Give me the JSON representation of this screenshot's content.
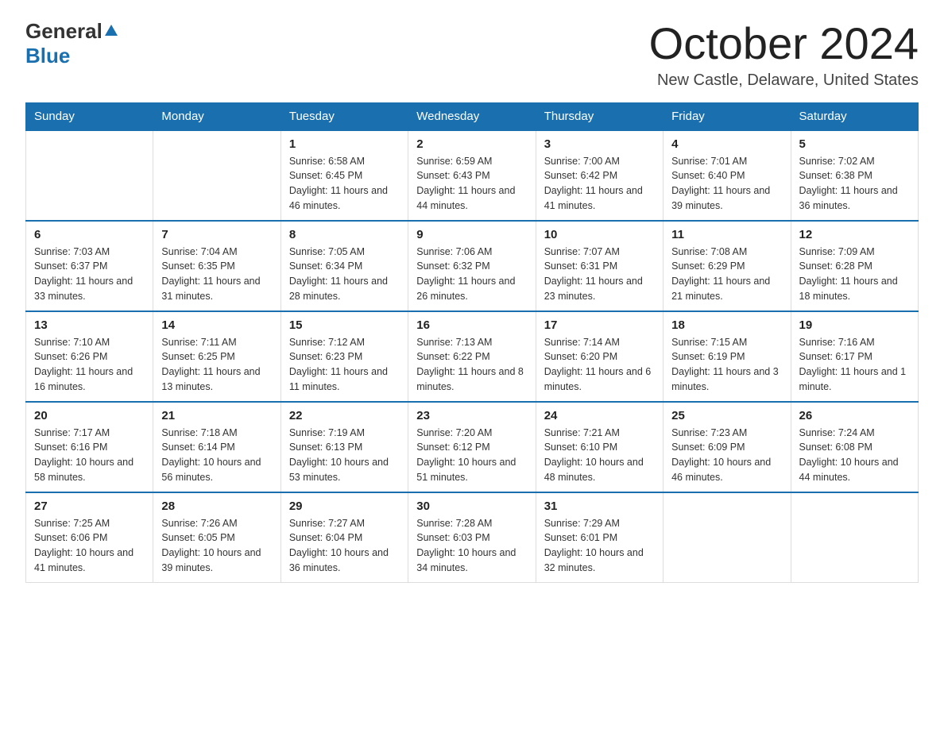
{
  "logo": {
    "general": "General",
    "blue": "Blue"
  },
  "title": "October 2024",
  "location": "New Castle, Delaware, United States",
  "days_of_week": [
    "Sunday",
    "Monday",
    "Tuesday",
    "Wednesday",
    "Thursday",
    "Friday",
    "Saturday"
  ],
  "weeks": [
    [
      {
        "day": "",
        "sunrise": "",
        "sunset": "",
        "daylight": ""
      },
      {
        "day": "",
        "sunrise": "",
        "sunset": "",
        "daylight": ""
      },
      {
        "day": "1",
        "sunrise": "Sunrise: 6:58 AM",
        "sunset": "Sunset: 6:45 PM",
        "daylight": "Daylight: 11 hours and 46 minutes."
      },
      {
        "day": "2",
        "sunrise": "Sunrise: 6:59 AM",
        "sunset": "Sunset: 6:43 PM",
        "daylight": "Daylight: 11 hours and 44 minutes."
      },
      {
        "day": "3",
        "sunrise": "Sunrise: 7:00 AM",
        "sunset": "Sunset: 6:42 PM",
        "daylight": "Daylight: 11 hours and 41 minutes."
      },
      {
        "day": "4",
        "sunrise": "Sunrise: 7:01 AM",
        "sunset": "Sunset: 6:40 PM",
        "daylight": "Daylight: 11 hours and 39 minutes."
      },
      {
        "day": "5",
        "sunrise": "Sunrise: 7:02 AM",
        "sunset": "Sunset: 6:38 PM",
        "daylight": "Daylight: 11 hours and 36 minutes."
      }
    ],
    [
      {
        "day": "6",
        "sunrise": "Sunrise: 7:03 AM",
        "sunset": "Sunset: 6:37 PM",
        "daylight": "Daylight: 11 hours and 33 minutes."
      },
      {
        "day": "7",
        "sunrise": "Sunrise: 7:04 AM",
        "sunset": "Sunset: 6:35 PM",
        "daylight": "Daylight: 11 hours and 31 minutes."
      },
      {
        "day": "8",
        "sunrise": "Sunrise: 7:05 AM",
        "sunset": "Sunset: 6:34 PM",
        "daylight": "Daylight: 11 hours and 28 minutes."
      },
      {
        "day": "9",
        "sunrise": "Sunrise: 7:06 AM",
        "sunset": "Sunset: 6:32 PM",
        "daylight": "Daylight: 11 hours and 26 minutes."
      },
      {
        "day": "10",
        "sunrise": "Sunrise: 7:07 AM",
        "sunset": "Sunset: 6:31 PM",
        "daylight": "Daylight: 11 hours and 23 minutes."
      },
      {
        "day": "11",
        "sunrise": "Sunrise: 7:08 AM",
        "sunset": "Sunset: 6:29 PM",
        "daylight": "Daylight: 11 hours and 21 minutes."
      },
      {
        "day": "12",
        "sunrise": "Sunrise: 7:09 AM",
        "sunset": "Sunset: 6:28 PM",
        "daylight": "Daylight: 11 hours and 18 minutes."
      }
    ],
    [
      {
        "day": "13",
        "sunrise": "Sunrise: 7:10 AM",
        "sunset": "Sunset: 6:26 PM",
        "daylight": "Daylight: 11 hours and 16 minutes."
      },
      {
        "day": "14",
        "sunrise": "Sunrise: 7:11 AM",
        "sunset": "Sunset: 6:25 PM",
        "daylight": "Daylight: 11 hours and 13 minutes."
      },
      {
        "day": "15",
        "sunrise": "Sunrise: 7:12 AM",
        "sunset": "Sunset: 6:23 PM",
        "daylight": "Daylight: 11 hours and 11 minutes."
      },
      {
        "day": "16",
        "sunrise": "Sunrise: 7:13 AM",
        "sunset": "Sunset: 6:22 PM",
        "daylight": "Daylight: 11 hours and 8 minutes."
      },
      {
        "day": "17",
        "sunrise": "Sunrise: 7:14 AM",
        "sunset": "Sunset: 6:20 PM",
        "daylight": "Daylight: 11 hours and 6 minutes."
      },
      {
        "day": "18",
        "sunrise": "Sunrise: 7:15 AM",
        "sunset": "Sunset: 6:19 PM",
        "daylight": "Daylight: 11 hours and 3 minutes."
      },
      {
        "day": "19",
        "sunrise": "Sunrise: 7:16 AM",
        "sunset": "Sunset: 6:17 PM",
        "daylight": "Daylight: 11 hours and 1 minute."
      }
    ],
    [
      {
        "day": "20",
        "sunrise": "Sunrise: 7:17 AM",
        "sunset": "Sunset: 6:16 PM",
        "daylight": "Daylight: 10 hours and 58 minutes."
      },
      {
        "day": "21",
        "sunrise": "Sunrise: 7:18 AM",
        "sunset": "Sunset: 6:14 PM",
        "daylight": "Daylight: 10 hours and 56 minutes."
      },
      {
        "day": "22",
        "sunrise": "Sunrise: 7:19 AM",
        "sunset": "Sunset: 6:13 PM",
        "daylight": "Daylight: 10 hours and 53 minutes."
      },
      {
        "day": "23",
        "sunrise": "Sunrise: 7:20 AM",
        "sunset": "Sunset: 6:12 PM",
        "daylight": "Daylight: 10 hours and 51 minutes."
      },
      {
        "day": "24",
        "sunrise": "Sunrise: 7:21 AM",
        "sunset": "Sunset: 6:10 PM",
        "daylight": "Daylight: 10 hours and 48 minutes."
      },
      {
        "day": "25",
        "sunrise": "Sunrise: 7:23 AM",
        "sunset": "Sunset: 6:09 PM",
        "daylight": "Daylight: 10 hours and 46 minutes."
      },
      {
        "day": "26",
        "sunrise": "Sunrise: 7:24 AM",
        "sunset": "Sunset: 6:08 PM",
        "daylight": "Daylight: 10 hours and 44 minutes."
      }
    ],
    [
      {
        "day": "27",
        "sunrise": "Sunrise: 7:25 AM",
        "sunset": "Sunset: 6:06 PM",
        "daylight": "Daylight: 10 hours and 41 minutes."
      },
      {
        "day": "28",
        "sunrise": "Sunrise: 7:26 AM",
        "sunset": "Sunset: 6:05 PM",
        "daylight": "Daylight: 10 hours and 39 minutes."
      },
      {
        "day": "29",
        "sunrise": "Sunrise: 7:27 AM",
        "sunset": "Sunset: 6:04 PM",
        "daylight": "Daylight: 10 hours and 36 minutes."
      },
      {
        "day": "30",
        "sunrise": "Sunrise: 7:28 AM",
        "sunset": "Sunset: 6:03 PM",
        "daylight": "Daylight: 10 hours and 34 minutes."
      },
      {
        "day": "31",
        "sunrise": "Sunrise: 7:29 AM",
        "sunset": "Sunset: 6:01 PM",
        "daylight": "Daylight: 10 hours and 32 minutes."
      },
      {
        "day": "",
        "sunrise": "",
        "sunset": "",
        "daylight": ""
      },
      {
        "day": "",
        "sunrise": "",
        "sunset": "",
        "daylight": ""
      }
    ]
  ]
}
